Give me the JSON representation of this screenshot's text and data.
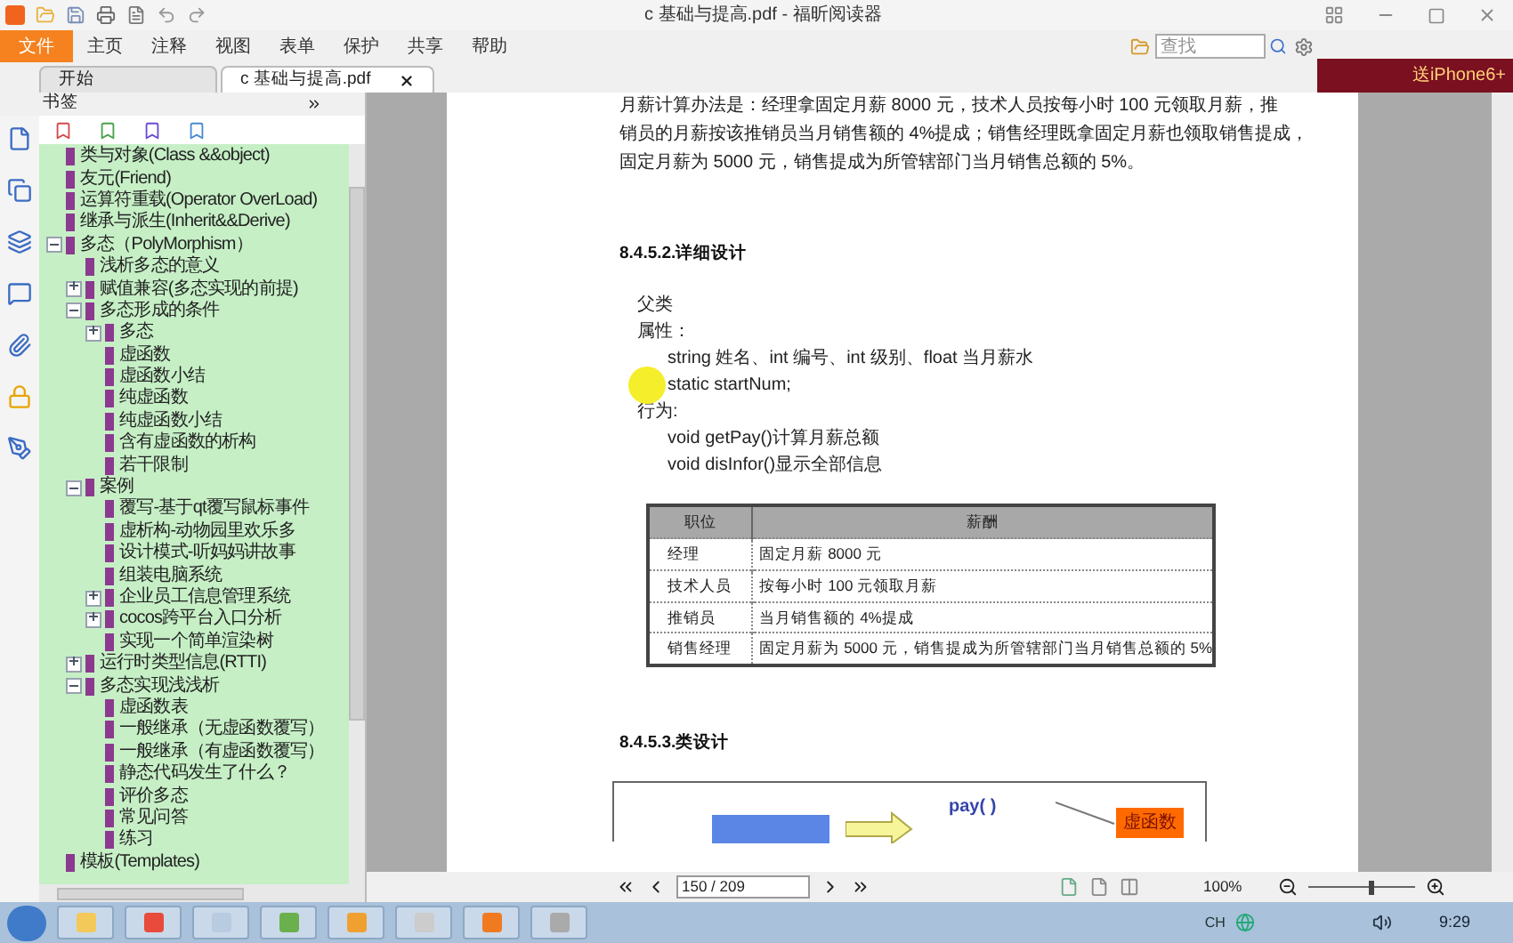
{
  "window": {
    "title": "c  基础与提高.pdf - 福昕阅读器"
  },
  "menu": [
    {
      "label": "文件",
      "selected": true
    },
    {
      "label": "主页",
      "selected": false
    },
    {
      "label": "注释",
      "selected": false
    },
    {
      "label": "视图",
      "selected": false
    },
    {
      "label": "表单",
      "selected": false
    },
    {
      "label": "保护",
      "selected": false
    },
    {
      "label": "共享",
      "selected": false
    },
    {
      "label": "帮助",
      "selected": false
    }
  ],
  "search": {
    "placeholder": "查找"
  },
  "ad": {
    "text": "送iPhone6+"
  },
  "tabs": [
    {
      "label": "开始",
      "selected": false,
      "closable": false
    },
    {
      "label": "c  基础与提高.pdf",
      "selected": true,
      "closable": true
    }
  ],
  "sidebar": {
    "title": "书签",
    "bookmarks": [
      {
        "label": "类与对象(Class &&object)"
      },
      {
        "label": "友元(Friend)"
      },
      {
        "label": "运算符重载(Operator OverLoad)"
      },
      {
        "label": "继承与派生(Inherit&&Derive)"
      },
      {
        "label": "多态（PolyMorphism）",
        "expanded": true,
        "children": [
          {
            "label": "浅析多态的意义"
          },
          {
            "label": "赋值兼容(多态实现的前提)",
            "expanded": false
          },
          {
            "label": "多态形成的条件",
            "expanded": true,
            "children": [
              {
                "label": "多态",
                "expanded": false
              },
              {
                "label": "虚函数"
              },
              {
                "label": "虚函数小结"
              },
              {
                "label": "纯虚函数"
              },
              {
                "label": "纯虚函数小结"
              },
              {
                "label": "含有虚函数的析构"
              },
              {
                "label": "若干限制"
              }
            ]
          },
          {
            "label": "案例",
            "expanded": true,
            "children": [
              {
                "label": "覆写-基于qt覆写鼠标事件"
              },
              {
                "label": "虚析构-动物园里欢乐多"
              },
              {
                "label": "设计模式-听妈妈讲故事"
              },
              {
                "label": "组装电脑系统"
              },
              {
                "label": "企业员工信息管理系统",
                "expanded": false
              },
              {
                "label": "cocos跨平台入口分析",
                "expanded": false
              },
              {
                "label": "实现一个简单渲染树"
              }
            ]
          },
          {
            "label": "运行时类型信息(RTTI)",
            "expanded": false
          },
          {
            "label": "多态实现浅浅析",
            "expanded": true,
            "children": [
              {
                "label": "虚函数表"
              },
              {
                "label": "一般继承（无虚函数覆写）"
              },
              {
                "label": "一般继承（有虚函数覆写）"
              },
              {
                "label": "静态代码发生了什么？"
              },
              {
                "label": "评价多态"
              },
              {
                "label": "常见问答"
              },
              {
                "label": "练习"
              }
            ]
          }
        ]
      },
      {
        "label": "模板(Templates)"
      }
    ]
  },
  "document": {
    "blocks": [
      {
        "kind": "para",
        "text": "月薪计算办法是：经理拿固定月薪 8000 元，技术人员按每小时 100 元领取月薪，推"
      },
      {
        "kind": "para",
        "text": "销员的月薪按该推销员当月销售额的 4%提成；销售经理既拿固定月薪也领取销售提成，"
      },
      {
        "kind": "para",
        "text": "固定月薪为 5000 元，销售提成为所管辖部门当月销售总额的 5%。"
      },
      {
        "kind": "heading",
        "text": "8.4.5.2.详细设计"
      },
      {
        "kind": "label",
        "text": "父类"
      },
      {
        "kind": "label",
        "text": "属性："
      },
      {
        "kind": "indented",
        "text": "string 姓名、int 编号、int 级别、float 当月薪水"
      },
      {
        "kind": "cursor",
        "text": "static startNum;"
      },
      {
        "kind": "label",
        "text": "行为:"
      },
      {
        "kind": "indented",
        "text": "void getPay()计算月薪总额"
      },
      {
        "kind": "indented",
        "text": "void disInfor()显示全部信息"
      },
      {
        "kind": "table",
        "columns": [
          "职位",
          "薪酬"
        ],
        "rows": [
          [
            "经理",
            "固定月薪 8000 元"
          ],
          [
            "技术人员",
            "按每小时 100 元领取月薪"
          ],
          [
            "推销员",
            "当月销售额的 4%提成"
          ],
          [
            "销售经理",
            "固定月薪为 5000 元，销售提成为所管辖部门当月销售总额的 5%"
          ]
        ]
      },
      {
        "kind": "heading",
        "text": "8.4.5.3.类设计"
      },
      {
        "kind": "diagram",
        "method": "pay( )",
        "tag": "虚函数"
      }
    ]
  },
  "navigation": {
    "page": "150 / 209",
    "zoom": "100%",
    "zoom_slider": {
      "level": 0.6
    }
  },
  "taskbar": {
    "language": "CH",
    "time": "9:29"
  }
}
